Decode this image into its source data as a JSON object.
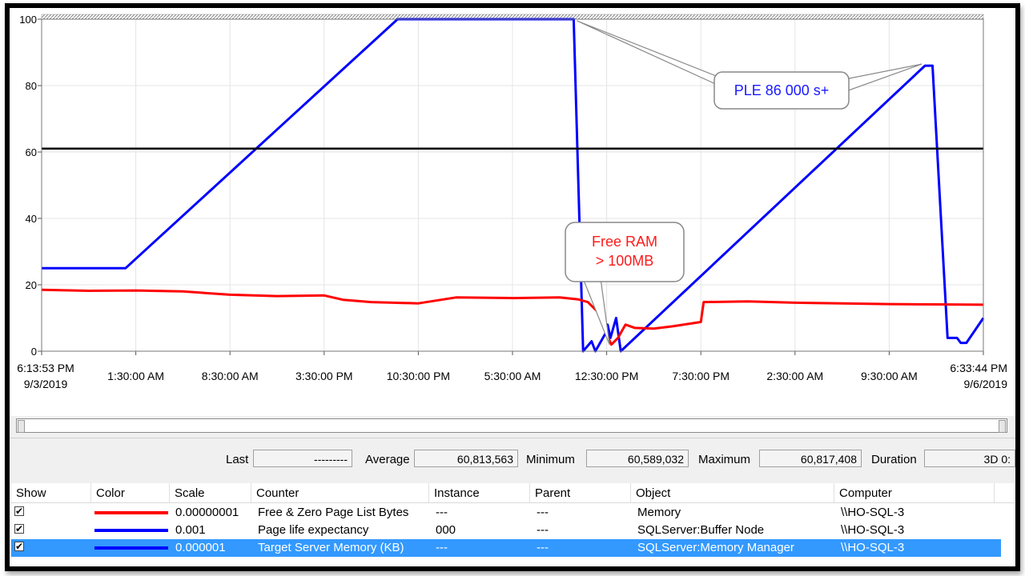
{
  "colors": {
    "red": "#ff0000",
    "blue": "#0000ff",
    "black": "#000000",
    "selection": "#3399ff"
  },
  "chart_data": {
    "type": "line",
    "y_ticks": [
      "100",
      "80",
      "60",
      "40",
      "20",
      "0"
    ],
    "ylim": [
      0,
      100
    ],
    "x_ticks": [
      {
        "line1": "6:13:53 PM",
        "line2": "9/3/2019"
      },
      {
        "line1": "1:30:00 AM"
      },
      {
        "line1": "8:30:00 AM"
      },
      {
        "line1": "3:30:00 PM"
      },
      {
        "line1": "10:30:00 PM"
      },
      {
        "line1": "5:30:00 AM"
      },
      {
        "line1": "12:30:00 PM"
      },
      {
        "line1": "7:30:00 PM"
      },
      {
        "line1": "2:30:00 AM"
      },
      {
        "line1": "9:30:00 AM"
      },
      {
        "line1": "6:33:44 PM",
        "line2": "9/6/2019"
      }
    ],
    "grid": true,
    "x_range": [
      0,
      1
    ],
    "series": [
      {
        "counter": "Page life expectancy",
        "color": "#0000ff",
        "points": [
          [
            0,
            25
          ],
          [
            0.089,
            25
          ],
          [
            0.378,
            100
          ],
          [
            0.565,
            100
          ],
          [
            0.575,
            0
          ],
          [
            0.584,
            3
          ],
          [
            0.588,
            0
          ],
          [
            0.6,
            6
          ],
          [
            0.601,
            8
          ],
          [
            0.604,
            4
          ],
          [
            0.61,
            10
          ],
          [
            0.615,
            0
          ],
          [
            0.938,
            86
          ],
          [
            0.946,
            86
          ],
          [
            0.962,
            4
          ],
          [
            0.972,
            4
          ],
          [
            0.976,
            2.5
          ],
          [
            0.982,
            2.5
          ],
          [
            1,
            10
          ]
        ]
      },
      {
        "counter": "Target Server Memory (KB)",
        "color": "#000000",
        "points": [
          [
            0,
            61
          ],
          [
            1,
            61
          ]
        ]
      },
      {
        "counter": "Free & Zero Page List Bytes",
        "color": "#ff0000",
        "points": [
          [
            0,
            18.5
          ],
          [
            0.05,
            18.2
          ],
          [
            0.1,
            18.3
          ],
          [
            0.15,
            18
          ],
          [
            0.2,
            17
          ],
          [
            0.25,
            16.6
          ],
          [
            0.3,
            16.8
          ],
          [
            0.32,
            15.5
          ],
          [
            0.35,
            14.8
          ],
          [
            0.4,
            14.4
          ],
          [
            0.44,
            16.2
          ],
          [
            0.5,
            16
          ],
          [
            0.55,
            16.2
          ],
          [
            0.57,
            15.6
          ],
          [
            0.58,
            14.8
          ],
          [
            0.59,
            12
          ],
          [
            0.595,
            11.5
          ],
          [
            0.6,
            5
          ],
          [
            0.605,
            2
          ],
          [
            0.612,
            4
          ],
          [
            0.62,
            8
          ],
          [
            0.63,
            7
          ],
          [
            0.65,
            6.8
          ],
          [
            0.67,
            7.5
          ],
          [
            0.7,
            8.8
          ],
          [
            0.703,
            14.8
          ],
          [
            0.75,
            15
          ],
          [
            0.8,
            14.6
          ],
          [
            0.85,
            14.4
          ],
          [
            0.9,
            14.2
          ],
          [
            0.95,
            14.1
          ],
          [
            1,
            14
          ]
        ]
      }
    ]
  },
  "annotations": {
    "ple": "PLE 86 000 s+",
    "free_ram_line1": "Free RAM",
    "free_ram_line2": "> 100MB"
  },
  "stats": {
    "last_label": "Last",
    "last_value": "---------",
    "average_label": "Average",
    "average_value": "60,813,563",
    "minimum_label": "Minimum",
    "minimum_value": "60,589,032",
    "maximum_label": "Maximum",
    "maximum_value": "60,817,408",
    "duration_label": "Duration",
    "duration_value": "3D 0:"
  },
  "counters_table": {
    "headers": [
      "Show",
      "Color",
      "Scale",
      "Counter",
      "Instance",
      "Parent",
      "Object",
      "Computer"
    ],
    "rows": [
      {
        "show": true,
        "color": "#ff0000",
        "scale": "0.00000001",
        "counter": "Free & Zero Page List Bytes",
        "instance": "---",
        "parent": "---",
        "object": "Memory",
        "computer": "\\\\HO-SQL-3",
        "selected": false
      },
      {
        "show": true,
        "color": "#0000ff",
        "scale": "0.001",
        "counter": "Page life expectancy",
        "instance": "000",
        "parent": "---",
        "object": "SQLServer:Buffer Node",
        "computer": "\\\\HO-SQL-3",
        "selected": false
      },
      {
        "show": true,
        "color": "#0000ff",
        "scale": "0.000001",
        "counter": "Target Server Memory (KB)",
        "instance": "---",
        "parent": "---",
        "object": "SQLServer:Memory Manager",
        "computer": "\\\\HO-SQL-3",
        "selected": true
      }
    ]
  }
}
